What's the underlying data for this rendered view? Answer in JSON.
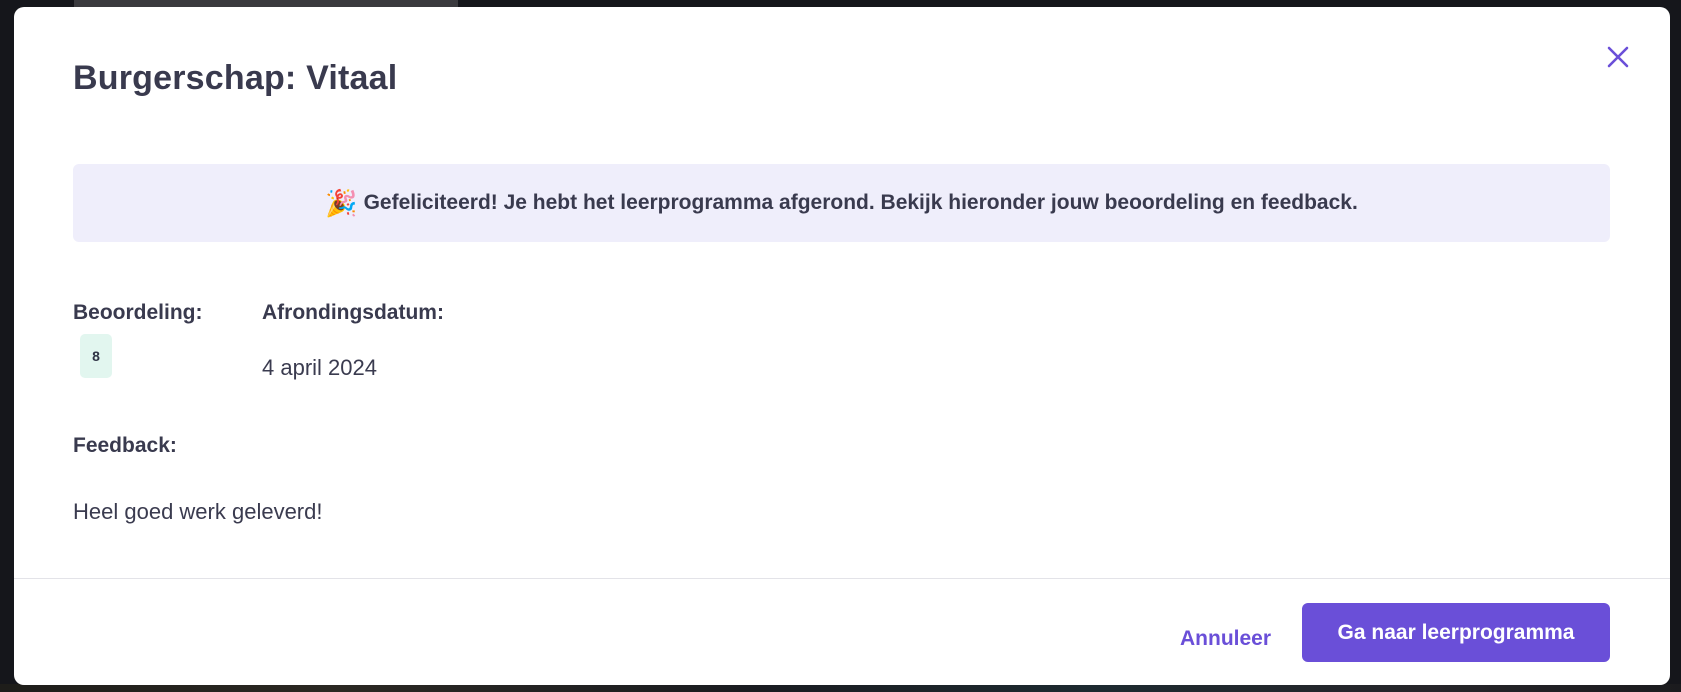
{
  "modal": {
    "title": "Burgerschap: Vitaal",
    "close_icon": "close-icon",
    "banner": {
      "icon": "party-popper-icon",
      "emoji": "🎉",
      "text": "Gefeliciteerd! Je hebt het leerprogramma afgerond. Bekijk hieronder jouw beoordeling en feedback."
    },
    "grade": {
      "label": "Beoordeling:",
      "value": "8"
    },
    "completion_date": {
      "label": "Afrondingsdatum:",
      "value": "4 april 2024"
    },
    "feedback": {
      "label": "Feedback:",
      "value": "Heel goed werk geleverd!"
    },
    "footer": {
      "cancel_label": "Annuleer",
      "primary_label": "Ga naar leerprogramma"
    }
  },
  "colors": {
    "accent": "#6a4fd8",
    "banner_bg": "#efeefb",
    "grade_badge_bg": "#e2f6ef",
    "text": "#393a4e"
  }
}
